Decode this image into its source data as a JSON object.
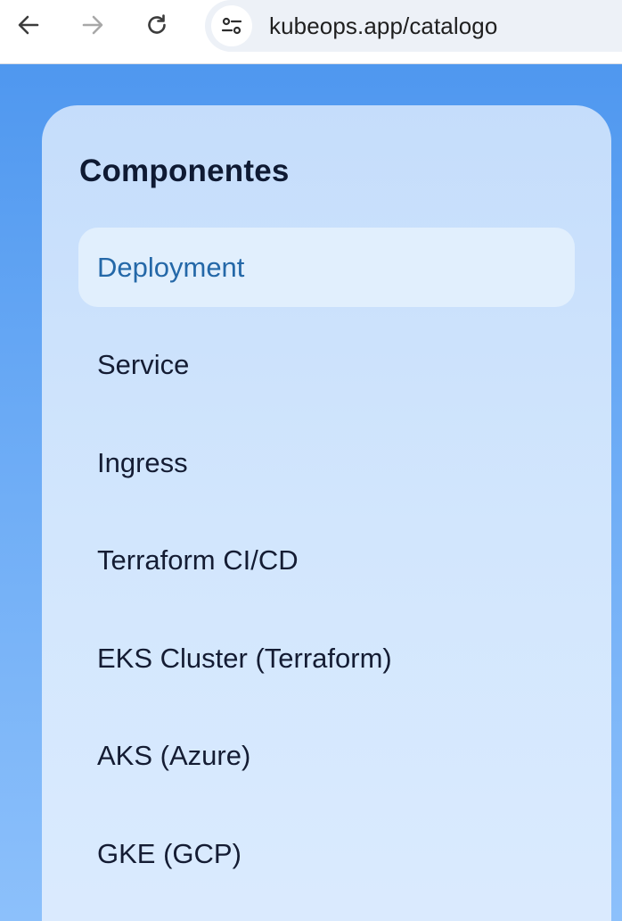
{
  "browser": {
    "url": "kubeops.app/catalogo",
    "back_icon": "arrow-left-icon",
    "forward_icon": "arrow-right-icon",
    "reload_icon": "reload-icon",
    "site_info_icon": "tune-icon"
  },
  "panel": {
    "title": "Componentes",
    "items": [
      {
        "label": "Deployment",
        "active": true
      },
      {
        "label": "Service",
        "active": false
      },
      {
        "label": "Ingress",
        "active": false
      },
      {
        "label": "Terraform CI/CD",
        "active": false
      },
      {
        "label": "EKS Cluster (Terraform)",
        "active": false
      },
      {
        "label": "AKS (Azure)",
        "active": false
      },
      {
        "label": "GKE (GCP)",
        "active": false
      }
    ]
  },
  "colors": {
    "page_background": "#4a94ee",
    "panel_background": "#cfe3fc",
    "active_item_background": "#e1effd",
    "active_item_text": "#2468a8",
    "item_text": "#141c33"
  }
}
